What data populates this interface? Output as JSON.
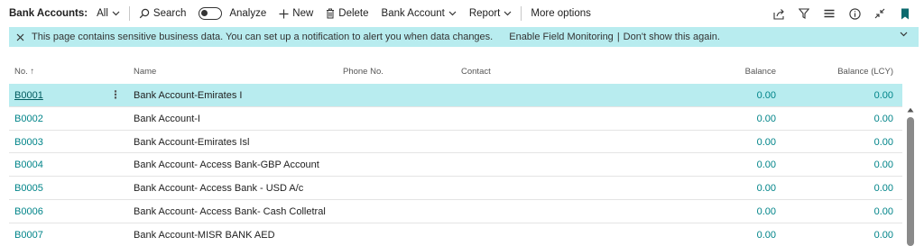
{
  "toolbar": {
    "title": "Bank Accounts:",
    "filter": "All",
    "search": "Search",
    "analyze": "Analyze",
    "new": "New",
    "delete": "Delete",
    "bank_account": "Bank Account",
    "report": "Report",
    "more_options": "More options"
  },
  "notification": {
    "message": "This page contains sensitive business data. You can set up a notification to alert you when data changes.",
    "enable_link": "Enable Field Monitoring",
    "separator": "|",
    "dismiss_link": "Don't show this again."
  },
  "columns": {
    "no": "No. ↑",
    "name": "Name",
    "phone": "Phone No.",
    "contact": "Contact",
    "balance": "Balance",
    "balance_lcy": "Balance (LCY)"
  },
  "rows": [
    {
      "no": "B0001",
      "name": "Bank Account-Emirates I",
      "balance": "0.00",
      "balance_lcy": "0.00",
      "selected": true
    },
    {
      "no": "B0002",
      "name": "Bank Account-I",
      "balance": "0.00",
      "balance_lcy": "0.00"
    },
    {
      "no": "B0003",
      "name": "Bank Account-Emirates Isl",
      "balance": "0.00",
      "balance_lcy": "0.00"
    },
    {
      "no": "B0004",
      "name": "Bank Account- Access Bank-GBP Account",
      "balance": "0.00",
      "balance_lcy": "0.00"
    },
    {
      "no": "B0005",
      "name": "Bank Account- Access Bank - USD A/c",
      "balance": "0.00",
      "balance_lcy": "0.00"
    },
    {
      "no": "B0006",
      "name": "Bank Account- Access Bank- Cash Colletral",
      "balance": "0.00",
      "balance_lcy": "0.00"
    },
    {
      "no": "B0007",
      "name": "Bank Account-MISR BANK AED",
      "balance": "0.00",
      "balance_lcy": "0.00"
    }
  ],
  "row_menu_glyph": "⋮",
  "icons": {
    "search": "search-icon",
    "new": "plus-icon",
    "delete": "trash-icon",
    "share": "share-icon",
    "filter": "filter-icon",
    "list": "list-icon",
    "info": "info-icon",
    "collapse": "collapse-icon",
    "bookmark": "bookmark-icon"
  },
  "colors": {
    "accent": "#008489",
    "notification_bg": "#b8ecef",
    "selected_row_bg": "#b8ecef",
    "bookmark": "#0b6a6e"
  }
}
